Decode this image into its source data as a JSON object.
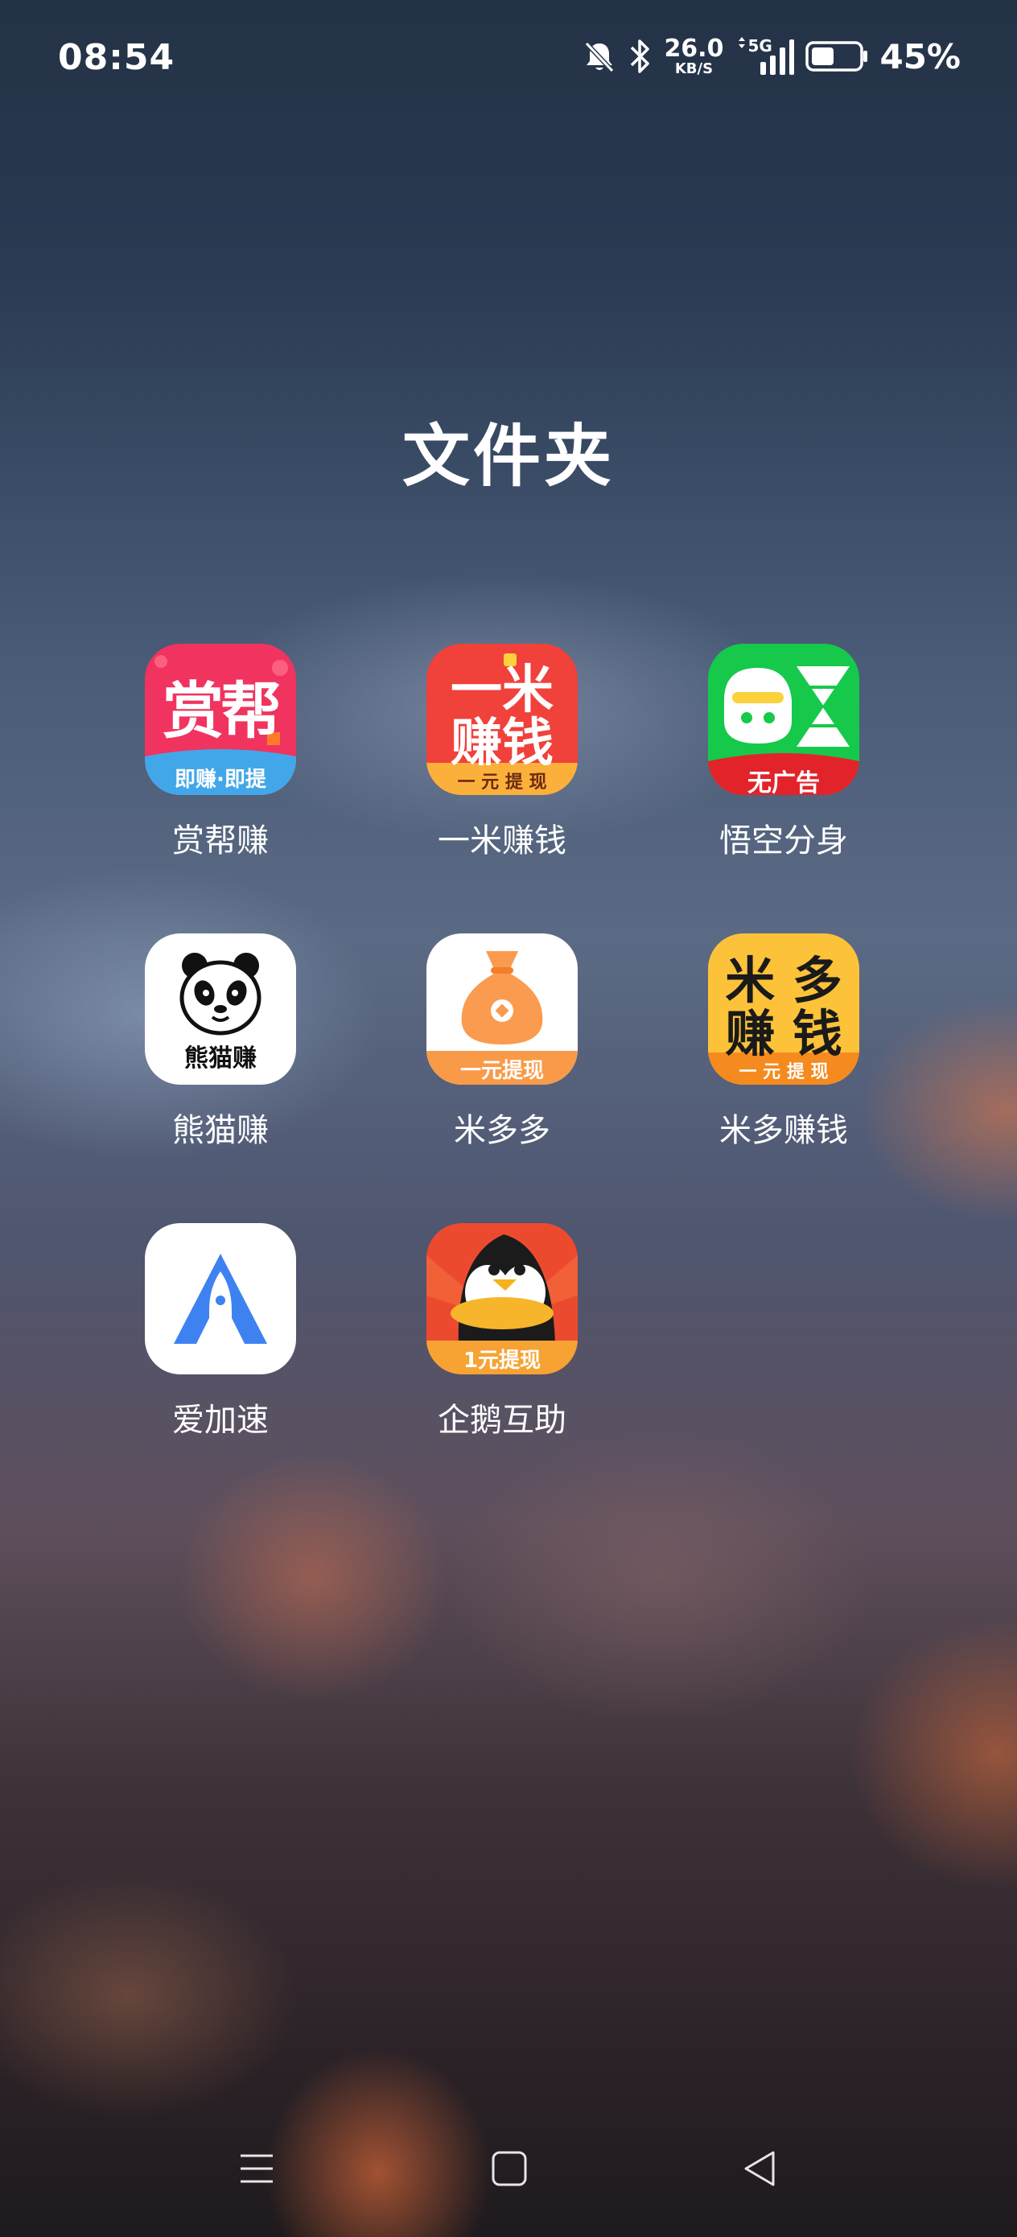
{
  "status_bar": {
    "time": "08:54",
    "net_speed_value": "26.0",
    "net_speed_unit": "KB/S",
    "network_type": "5G",
    "battery_percent": "45%",
    "battery_level": 0.45,
    "icons": [
      "bell-muted-icon",
      "bluetooth-icon",
      "signal-icon",
      "battery-icon"
    ]
  },
  "folder": {
    "title": "文件夹"
  },
  "apps": [
    {
      "label": "赏帮赚",
      "icon_text_top": "赏帮",
      "icon_text_bottom": "即赚·即提",
      "colors": {
        "bg": "#f0345f",
        "band": "#42a7e8"
      }
    },
    {
      "label": "一米赚钱",
      "icon_text_top": "一米",
      "icon_text_mid": "赚钱",
      "icon_text_bottom": "一 元 提 现",
      "colors": {
        "bg": "#f0413b",
        "band": "#fbb03b"
      }
    },
    {
      "label": "悟空分身",
      "icon_text_bottom": "无广告",
      "colors": {
        "bg": "#16c94b",
        "band": "#e3232a"
      }
    },
    {
      "label": "熊猫赚",
      "icon_text_bottom": "熊猫赚",
      "colors": {
        "bg": "#ffffff"
      }
    },
    {
      "label": "米多多",
      "icon_text_bottom": "一元提现",
      "colors": {
        "bg": "#ffffff",
        "band": "#f99a48",
        "bag": "#fa9b4f"
      }
    },
    {
      "label": "米多赚钱",
      "icon_text_top": "米 多",
      "icon_text_mid": "赚 钱",
      "icon_text_bottom": "一 元 提 现",
      "colors": {
        "bg": "#fcc239",
        "band": "#f58a1f"
      }
    },
    {
      "label": "爱加速",
      "colors": {
        "bg": "#ffffff",
        "accent": "#3e82f1"
      }
    },
    {
      "label": "企鹅互助",
      "icon_text_bottom": "1元提现",
      "colors": {
        "bg": "#ec4a2e",
        "band": "#f6a334"
      }
    }
  ],
  "nav_bar": {
    "buttons": [
      "menu",
      "home",
      "back"
    ]
  }
}
